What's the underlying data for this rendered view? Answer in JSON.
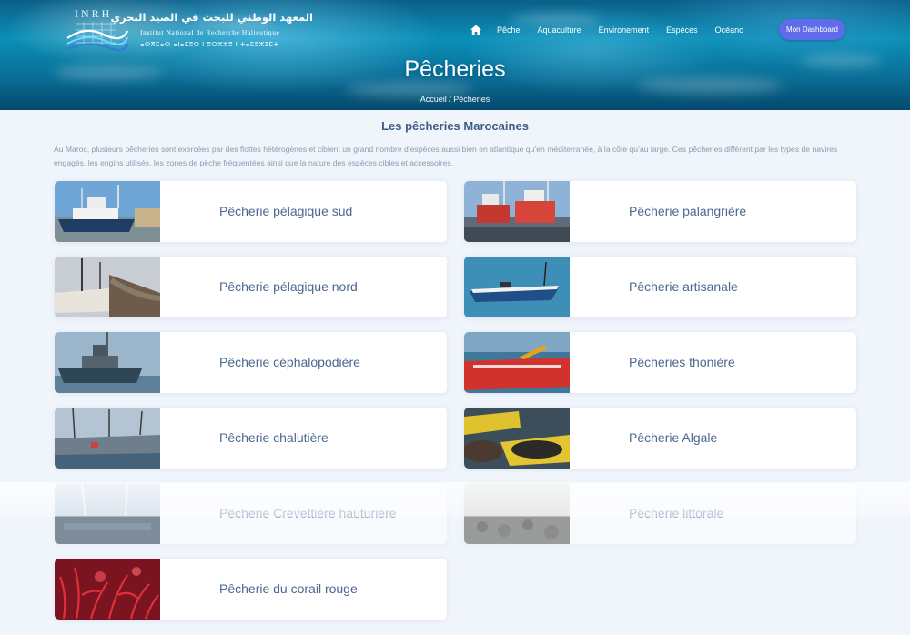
{
  "header": {
    "logo": {
      "abbr": "INRH",
      "arabic_name": "المعهد الوطني للبحث في الصيد البحري",
      "french_name": "Institut National de Recherche Halieutique",
      "tifinagh_name": "ⴰⵙⴳⵎⴰⵔ ⴰⵏⴰⵎⵓⵔ ⵏ ⵓⵔⵣⵣⵓ ⵏ ⵜⴰⵎⵓⵣⵉⵎⵜ"
    },
    "nav": {
      "home_icon": "home-icon",
      "items": [
        "Pêche",
        "Aquaculture",
        "Environement",
        "Espèces",
        "Océano"
      ],
      "dashboard_button": "Mon Dashboard"
    },
    "page_title": "Pêcheries",
    "breadcrumb": {
      "home": "Accueil",
      "separator": " / ",
      "current": "Pêcheries"
    }
  },
  "main": {
    "section_title": "Les pêcheries Marocaines",
    "intro": "Au Maroc, plusieurs pêcheries sont exercées par des flottes hétérogènes et ciblent un grand nombre d’espèces aussi bien en atlantique qu’en méditerranée, à la côte qu’au large. Ces pêcheries diffèrent par les types de navires engagés, les engins utilisés, les zones de pêche fréquentées ainsi que la nature des espèces cibles et accessoires.",
    "fisheries": [
      {
        "label": "Pêcherie pélagique sud"
      },
      {
        "label": "Pêcherie palangrière"
      },
      {
        "label": "Pêcherie pélagique nord"
      },
      {
        "label": "Pêcherie artisanale"
      },
      {
        "label": "Pêcherie céphalopodière"
      },
      {
        "label": "Pêcheries thonière"
      },
      {
        "label": "Pêcherie chalutière"
      },
      {
        "label": "Pêcherie Algale"
      },
      {
        "label": "Pêcherie Crevettière hauturière"
      },
      {
        "label": "Pêcherie littorale"
      },
      {
        "label": "Pêcherie du corail rouge"
      }
    ]
  },
  "colors": {
    "accent_button": "#5f6bea",
    "card_text": "#4b6891",
    "background": "#f0f4fb"
  }
}
